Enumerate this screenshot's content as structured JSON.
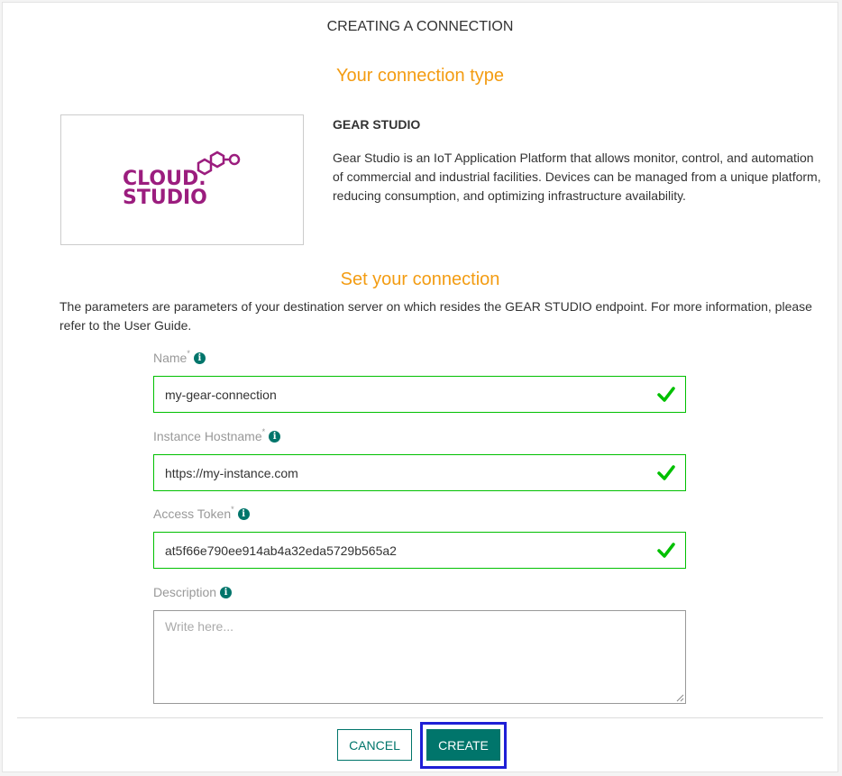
{
  "dialog": {
    "title": "CREATING A CONNECTION"
  },
  "connection_type": {
    "heading": "Your connection type",
    "logo": {
      "line1": "CLOUD.",
      "line2": "STUDIO",
      "color": "#9b1d7e"
    },
    "name": "GEAR STUDIO",
    "description": "Gear Studio is an IoT Application Platform that allows monitor, control, and automation of commercial and industrial facilities. Devices can be managed from a unique platform, reducing consumption, and optimizing infrastructure availability."
  },
  "set_connection": {
    "heading": "Set your connection",
    "intro": "The parameters are parameters of your destination server on which resides the GEAR STUDIO endpoint. For more information, please refer to the User Guide."
  },
  "fields": {
    "name": {
      "label": "Name",
      "required_mark": "*",
      "value": "my-gear-connection"
    },
    "hostname": {
      "label": "Instance Hostname",
      "required_mark": "*",
      "value": "https://my-instance.com"
    },
    "token": {
      "label": "Access Token",
      "required_mark": "*",
      "value": "at5f66e790ee914ab4a32eda5729b565a2"
    },
    "description": {
      "label": "Description",
      "placeholder": "Write here..."
    }
  },
  "buttons": {
    "cancel": "CANCEL",
    "create": "CREATE"
  },
  "colors": {
    "accent": "#00756b",
    "heading": "#f39c12",
    "valid": "#00c000",
    "focus": "#1f1fd6"
  }
}
